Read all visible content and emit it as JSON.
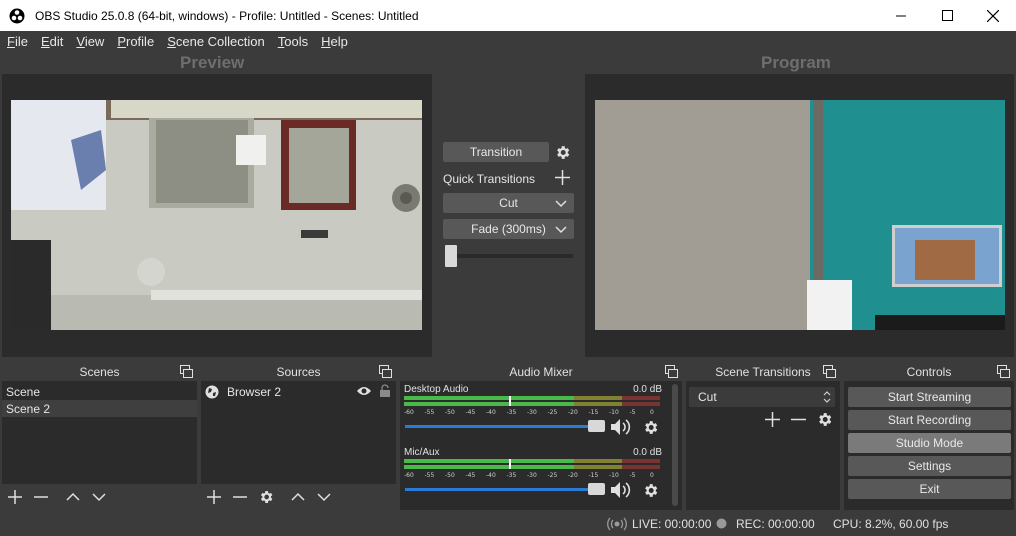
{
  "window": {
    "title": "OBS Studio 25.0.8 (64-bit, windows) - Profile: Untitled - Scenes: Untitled",
    "minimize": "—",
    "maximize": "☐",
    "close": "✕"
  },
  "menu": [
    {
      "pre": "",
      "ul": "F",
      "post": "ile"
    },
    {
      "pre": "",
      "ul": "E",
      "post": "dit"
    },
    {
      "pre": "",
      "ul": "V",
      "post": "iew"
    },
    {
      "pre": "",
      "ul": "P",
      "post": "rofile"
    },
    {
      "pre": "",
      "ul": "S",
      "post": "cene Collection"
    },
    {
      "pre": "",
      "ul": "T",
      "post": "ools"
    },
    {
      "pre": "",
      "ul": "H",
      "post": "elp"
    }
  ],
  "preview_label": "Preview",
  "program_label": "Program",
  "transition": {
    "button": "Transition",
    "quick_label": "Quick Transitions",
    "cut": "Cut",
    "fade": "Fade (300ms)",
    "tbar_value": 0
  },
  "scenes": {
    "title": "Scenes",
    "items": [
      "Scene",
      "Scene 2"
    ],
    "selected_index": 1
  },
  "sources": {
    "title": "Sources",
    "items": [
      "Browser 2"
    ]
  },
  "mixer": {
    "title": "Audio Mixer",
    "channels": [
      {
        "name": "Desktop Audio",
        "db": "0.0 dB",
        "volume": 1.0
      },
      {
        "name": "Mic/Aux",
        "db": "0.0 dB",
        "volume": 1.0
      }
    ],
    "scale": [
      "-60",
      "-55",
      "-50",
      "-45",
      "-40",
      "-35",
      "-30",
      "-25",
      "-20",
      "-15",
      "-10",
      "-5",
      "0"
    ]
  },
  "scene_transitions": {
    "title": "Scene Transitions",
    "selected": "Cut"
  },
  "controls": {
    "title": "Controls",
    "buttons": [
      "Start Streaming",
      "Start Recording",
      "Studio Mode",
      "Settings",
      "Exit"
    ]
  },
  "status": {
    "live": "LIVE: 00:00:00",
    "rec": "REC: 00:00:00",
    "cpu": "CPU: 8.2%, 60.00 fps"
  },
  "colors": {
    "meter_green": "#4bb84b",
    "meter_yellow": "#c9c93a",
    "meter_red": "#b83a3a",
    "slider_blue": "#2a7bd6"
  }
}
